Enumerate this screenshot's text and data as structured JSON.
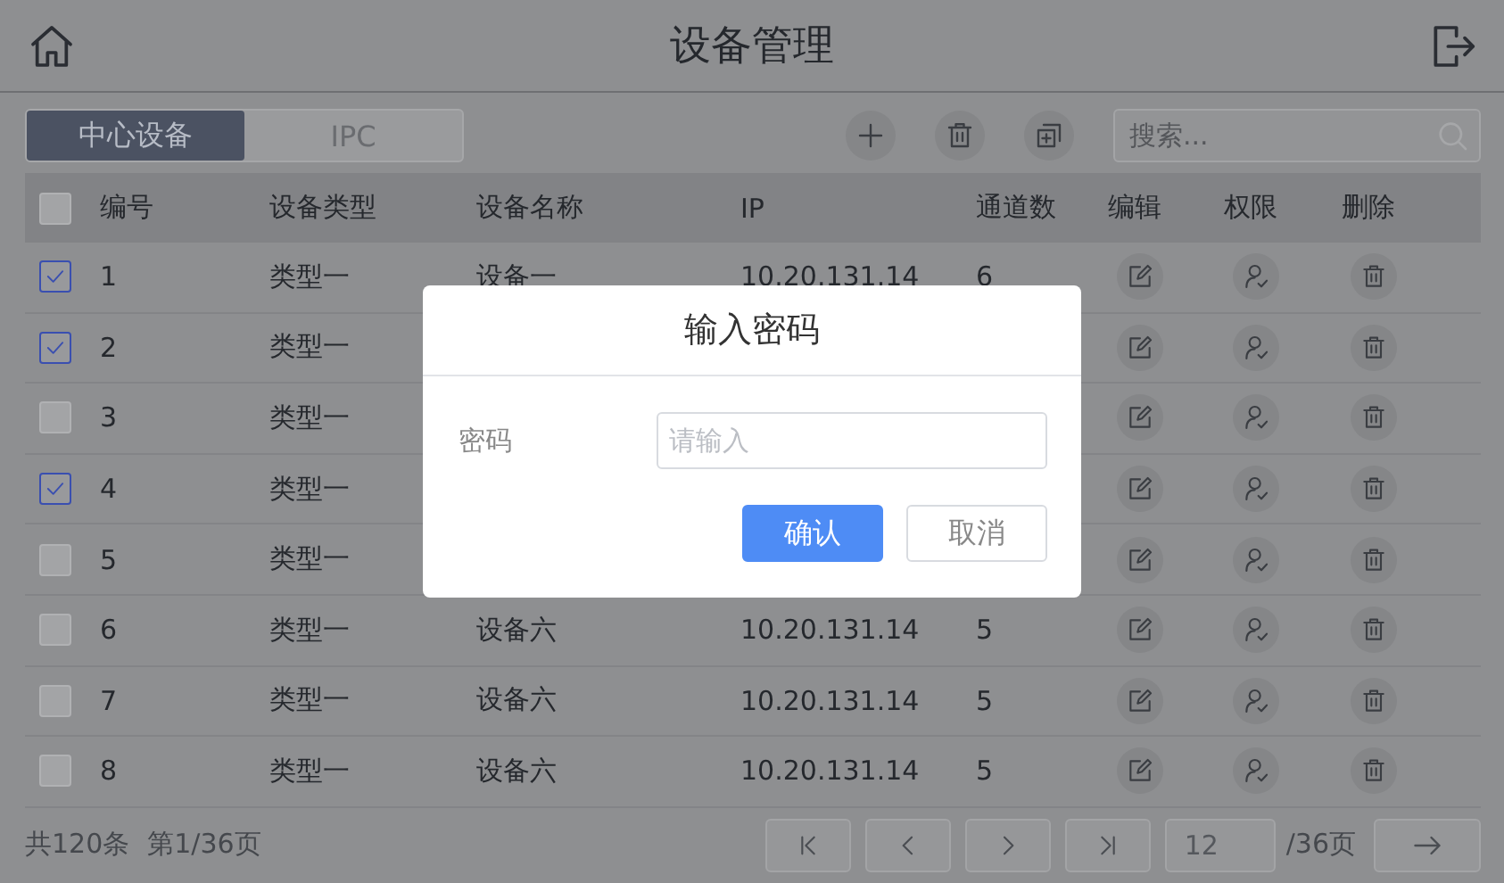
{
  "header": {
    "title": "设备管理"
  },
  "tabs": [
    {
      "label": "中心设备",
      "selected": true
    },
    {
      "label": "IPC",
      "selected": false
    }
  ],
  "search": {
    "placeholder": "搜索..."
  },
  "table": {
    "select_all": {
      "checked": false
    },
    "columns": [
      "编号",
      "设备类型",
      "设备名称",
      "IP",
      "通道数",
      "编辑",
      "权限",
      "删除"
    ],
    "rows": [
      {
        "checked": true,
        "no": "1",
        "type": "类型一",
        "name": "设备一",
        "ip": "10.20.131.14",
        "channels": "6"
      },
      {
        "checked": true,
        "no": "2",
        "type": "类型一"
      },
      {
        "checked": false,
        "no": "3",
        "type": "类型一"
      },
      {
        "checked": true,
        "no": "4",
        "type": "类型一"
      },
      {
        "checked": false,
        "no": "5",
        "type": "类型一"
      },
      {
        "checked": false,
        "no": "6",
        "type": "类型一",
        "name": "设备六",
        "ip": "10.20.131.14",
        "channels": "5"
      },
      {
        "checked": false,
        "no": "7",
        "type": "类型一",
        "name": "设备六",
        "ip": "10.20.131.14",
        "channels": "5"
      },
      {
        "checked": false,
        "no": "8",
        "type": "类型一",
        "name": "设备六",
        "ip": "10.20.131.14",
        "channels": "5"
      }
    ]
  },
  "footer": {
    "total": "共120条",
    "page": "第1/36页",
    "page_input": "12",
    "page_count": "/36页"
  },
  "dialog": {
    "title": "输入密码",
    "label": "密码",
    "placeholder": "请输入",
    "confirm": "确认",
    "cancel": "取消"
  }
}
